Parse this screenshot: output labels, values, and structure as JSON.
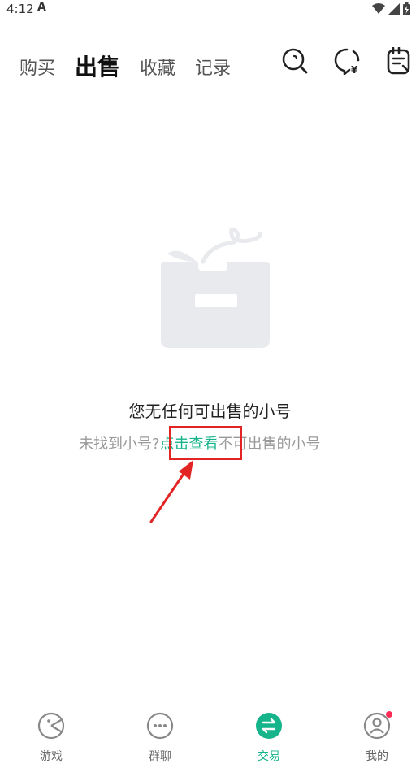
{
  "status_bar": {
    "time": "4:12",
    "app_glyph": "A"
  },
  "top_tabs": [
    {
      "label": "购买",
      "active": false
    },
    {
      "label": "出售",
      "active": true
    },
    {
      "label": "收藏",
      "active": false
    },
    {
      "label": "记录",
      "active": false
    }
  ],
  "top_icons": [
    "search-icon",
    "chat-money-icon",
    "note-icon"
  ],
  "empty_state": {
    "title": "您无任何可出售的小号",
    "sub_prefix": "未找到小号?",
    "sub_link": "点击查看",
    "sub_suffix": "不可出售的小号"
  },
  "bottom_nav": [
    {
      "label": "游戏",
      "icon": "game-icon",
      "active": false
    },
    {
      "label": "群聊",
      "icon": "group-chat-icon",
      "active": false
    },
    {
      "label": "交易",
      "icon": "trade-icon",
      "active": true
    },
    {
      "label": "我的",
      "icon": "profile-icon",
      "active": false,
      "badge": true
    }
  ],
  "colors": {
    "accent": "#16b48a",
    "annotation": "#e32424",
    "badge": "#ff2d55",
    "illustration": "#e8eaed"
  }
}
